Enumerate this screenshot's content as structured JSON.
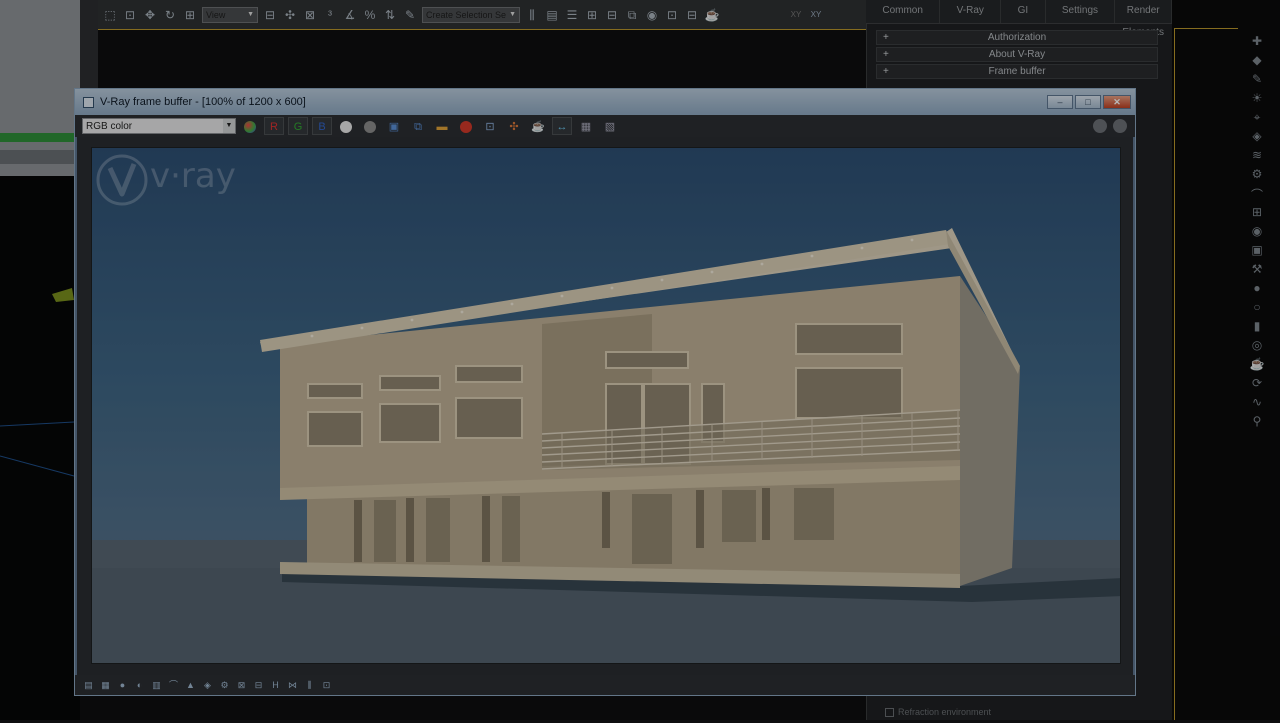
{
  "max_toolbar": {
    "view_dropdown": "View",
    "selection_set_placeholder": "Create Selection Se",
    "xy_labels": [
      "XY",
      "XY"
    ]
  },
  "render_setup": {
    "tabs": [
      "Common",
      "V-Ray",
      "GI",
      "Settings",
      "Render Elements"
    ],
    "rollouts": [
      "Authorization",
      "About V-Ray",
      "Frame buffer"
    ],
    "refraction_label": "Refraction environment"
  },
  "frame_buffer": {
    "title": "V-Ray frame buffer - [100% of 1200 x 600]",
    "channel": "RGB color",
    "channel_buttons": [
      "R",
      "G",
      "B"
    ],
    "window_buttons": {
      "minimize": "–",
      "maximize": "□",
      "close": "✕"
    },
    "logo_text": "v·ray"
  },
  "colors": {
    "accent": "#b9962c",
    "titlebar": "#a6bdd3",
    "sky": "#3f6685",
    "building": "#c8b89a"
  }
}
